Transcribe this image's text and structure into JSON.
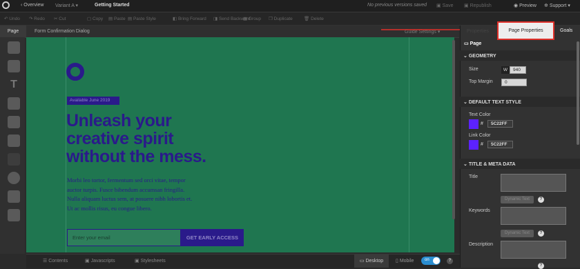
{
  "topbar": {
    "overview": "Overview",
    "variant": "Variant A",
    "page_name": "Getting Started",
    "status": "No previous versions saved",
    "save": "Save",
    "publish": "Republish",
    "preview": "Preview",
    "support": "Support"
  },
  "toolbar": [
    "Undo",
    "Redo",
    "Cut",
    "Copy",
    "Paste",
    "Paste Style",
    "Bring Forward",
    "Send Backward",
    "Group",
    "Duplicate",
    "Delete"
  ],
  "tabs": {
    "page": "Page",
    "form_confirmation": "Form Confirmation Dialog",
    "guide_settings": "Guide Settings"
  },
  "left_tools": [
    "section-icon",
    "box-icon",
    "text-icon",
    "image-icon",
    "image-group-icon",
    "form-icon",
    "button-icon",
    "video-icon",
    "code-icon",
    "social-icon"
  ],
  "canvas": {
    "badge": "Available June 2019",
    "headline_lines": [
      "Unleash your",
      "creative spirit",
      "without the mess."
    ],
    "body_lines": [
      "Morbi leo tortor, fermentum sed orci vitae, tempor",
      "auctor turpis. Fusce bibendum accumsan fringilla.",
      "Nulla aliquam luctus sem, at posuere nibh lobortis et.",
      "Ut ac mollis risus, eu congue libero."
    ],
    "email_placeholder": "Enter your email",
    "cta": "GET EARLY ACCESS",
    "bg_color": "#1f7650",
    "brand_color": "#2a1a8a"
  },
  "sidebar": {
    "tab_properties": "Properties",
    "tab_page_properties": "Page Properties",
    "tab_goals": "Goals",
    "page_label": "Page",
    "geometry": "GEOMETRY",
    "size_label": "Size",
    "size_prefix": "W",
    "size_value": "940",
    "top_margin_label": "Top Margin",
    "top_margin_value": "0",
    "default_text_style": "DEFAULT TEXT STYLE",
    "text_color_label": "Text Color",
    "text_color_value": "5C22FF",
    "link_color_label": "Link Color",
    "link_color_value": "5C22FF",
    "hash": "#",
    "title_meta": "TITLE & META DATA",
    "title_label": "Title",
    "keywords_label": "Keywords",
    "description_label": "Description",
    "dynamic_text": "Dynamic Text",
    "help": "?"
  },
  "bottombar": {
    "contents": "Contents",
    "javascripts": "Javascripts",
    "stylesheets": "Stylesheets",
    "desktop": "Desktop",
    "mobile": "Mobile",
    "toggle": "on"
  },
  "annotation_color": "#e0302a"
}
